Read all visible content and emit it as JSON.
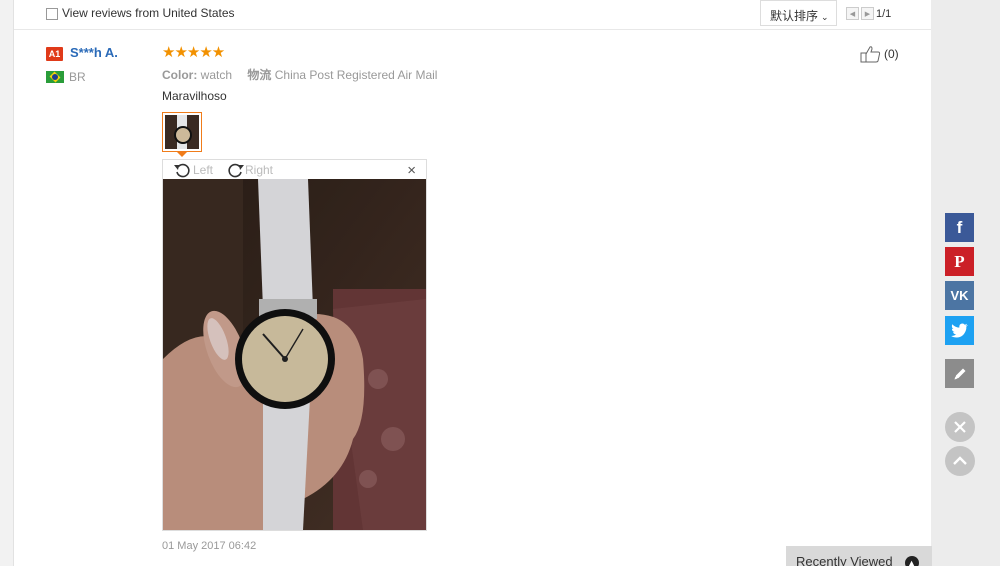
{
  "filter": {
    "checkbox_label": "View reviews from United States",
    "sort_label": "默认排序",
    "pager_text": "1/1"
  },
  "review": {
    "level_badge": "A1",
    "reviewer_name": "S***h A.",
    "country": "BR",
    "stars": "★★★★★",
    "color_key": "Color:",
    "color_value": "watch",
    "shipping_key": "物流",
    "shipping_value": "China Post Registered Air Mail",
    "text": "Maravilhoso",
    "helpful_count": "(0)",
    "date": "01 May 2017 06:42"
  },
  "viewer": {
    "rotate_left_label": "Left",
    "rotate_right_label": "Right",
    "close_glyph": "×"
  },
  "share": {
    "facebook_glyph": "f",
    "pinterest_glyph": "P",
    "vk_glyph": "VK"
  },
  "recently_viewed": {
    "label": "Recently Viewed"
  },
  "colors": {
    "accent_orange": "#f07c1a",
    "star": "#f29100",
    "name_blue": "#2a6ab8",
    "facebook": "#3b5998",
    "pinterest": "#cb2027",
    "vk": "#4c75a3",
    "twitter": "#1da1f2"
  },
  "icons": {
    "checkbox": "checkbox-icon",
    "thumbs_up": "thumbs-up-icon",
    "rotate_left": "rotate-left-icon",
    "rotate_right": "rotate-right-icon",
    "close": "close-icon",
    "edit": "pencil-icon",
    "back_to_top": "chevron-up-icon"
  }
}
